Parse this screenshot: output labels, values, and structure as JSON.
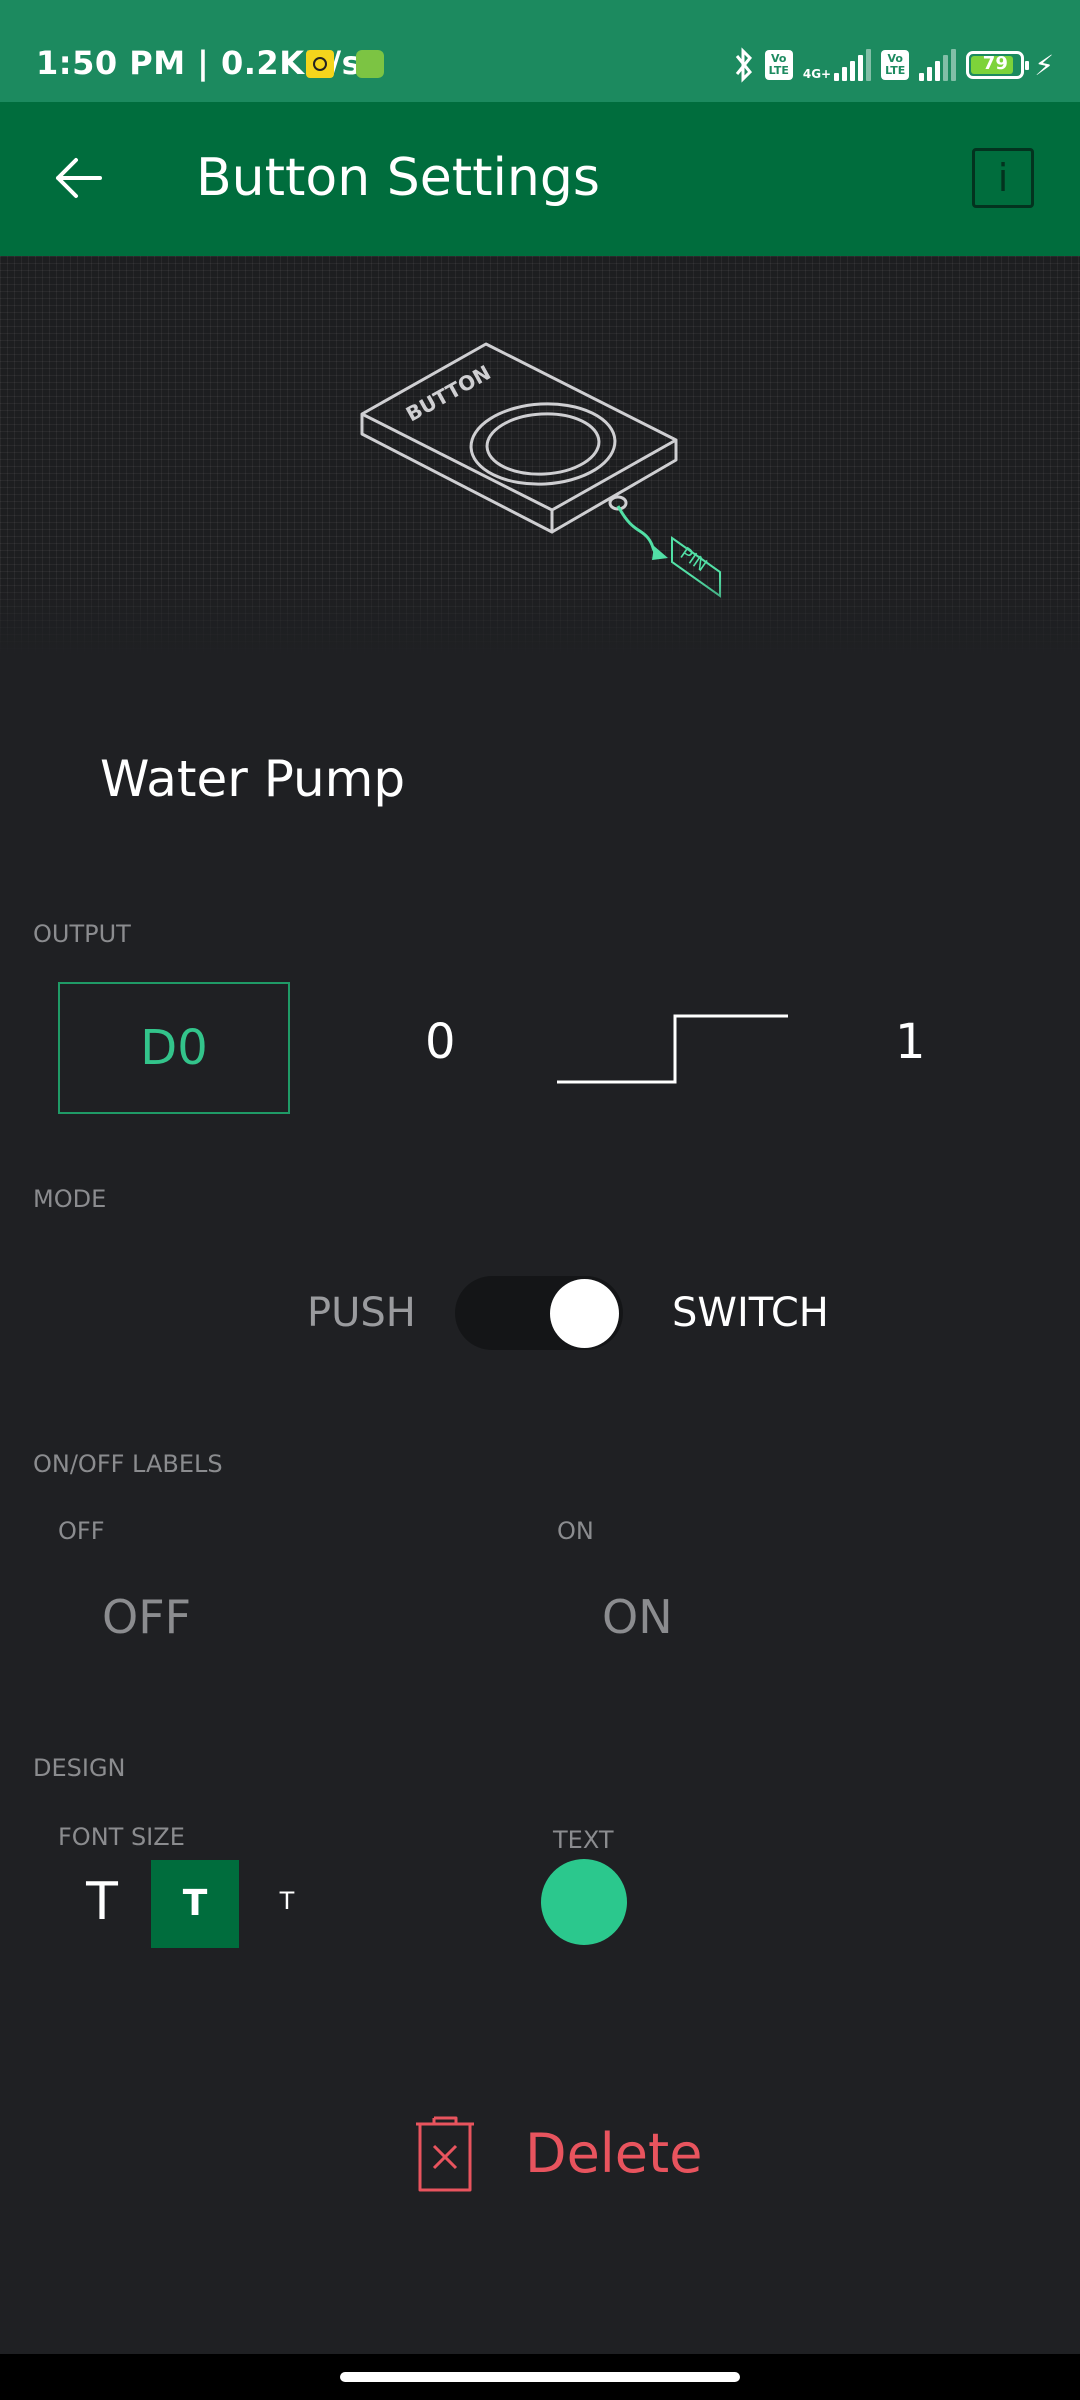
{
  "status_bar": {
    "time_speed": "1:50 PM | 0.2KB/s",
    "network_label": "4G+",
    "volte_label": "Vo LTE",
    "battery_level": "79",
    "colors": {
      "background": "#1c8a5f",
      "battery_fill": "#7dd33a"
    }
  },
  "app_bar": {
    "title": "Button Settings",
    "info_icon_glyph": "i",
    "background": "#006d3d"
  },
  "hero": {
    "device_label": "BUTTON",
    "pin_label": "PIN"
  },
  "widget": {
    "name": "Water Pump"
  },
  "output": {
    "section_label": "OUTPUT",
    "pin": "D0",
    "low_value": "0",
    "high_value": "1",
    "accent": "#33c48b"
  },
  "mode": {
    "section_label": "MODE",
    "push_label": "PUSH",
    "switch_label": "SWITCH",
    "selected": "SWITCH"
  },
  "onoff_labels": {
    "section_label": "ON/OFF LABELS",
    "off_caption": "OFF",
    "on_caption": "ON",
    "off_value": "OFF",
    "on_value": "ON"
  },
  "design": {
    "section_label": "DESIGN",
    "font_size_label": "FONT SIZE",
    "text_label": "TEXT",
    "font_options": [
      "T",
      "T",
      "T"
    ],
    "selected_font_index": 1,
    "text_color": "#2bc88d"
  },
  "actions": {
    "delete_label": "Delete",
    "delete_color": "#e8545e"
  }
}
